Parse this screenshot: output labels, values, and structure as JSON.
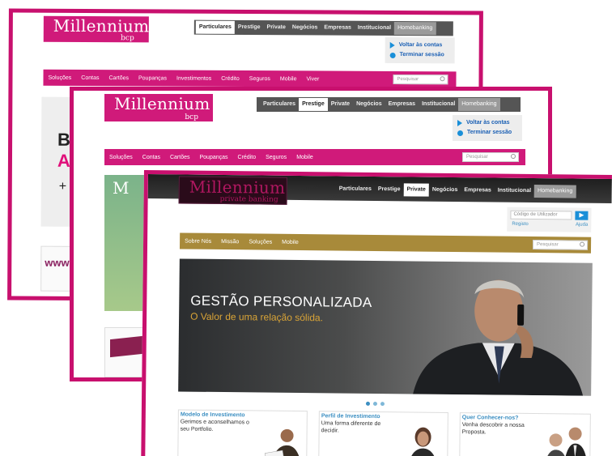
{
  "window1": {
    "logo_big": "Millennium",
    "logo_small": "bcp",
    "nav": [
      "Particulares",
      "Prestige",
      "Private",
      "Negócios",
      "Empresas",
      "Institucional",
      "Homebanking"
    ],
    "actions": [
      "Voltar às contas",
      "Terminar sessão"
    ],
    "menu": [
      "Soluções",
      "Contas",
      "Cartões",
      "Poupanças",
      "Investimentos",
      "Crédito",
      "Seguros",
      "Mobile",
      "Viver"
    ],
    "search_placeholder": "Pesquisar",
    "banner_text": [
      "B",
      "A",
      "+"
    ],
    "promo_text": "www"
  },
  "window2": {
    "logo_big": "Millennium",
    "logo_small": "bcp",
    "nav": [
      "Particulares",
      "Prestige",
      "Private",
      "Negócios",
      "Empresas",
      "Institucional",
      "Homebanking"
    ],
    "actions": [
      "Voltar às contas",
      "Terminar sessão"
    ],
    "menu": [
      "Soluções",
      "Contas",
      "Cartões",
      "Poupanças",
      "Crédito",
      "Seguros",
      "Mobile"
    ],
    "search_placeholder": "Pesquisar",
    "banner_letter": "M"
  },
  "window3": {
    "logo_big": "Millennium",
    "logo_small": "private banking",
    "nav": [
      "Particulares",
      "Prestige",
      "Private",
      "Negócios",
      "Empresas",
      "Institucional",
      "Homebanking"
    ],
    "login_placeholder": "Código de Utilizador",
    "link_register": "Registo",
    "link_help": "Ajuda",
    "menu": [
      "Sobre Nós",
      "Missão",
      "Soluções",
      "Mobile"
    ],
    "search_placeholder": "Pesquisar",
    "hero_title": "GESTÃO PERSONALIZADA",
    "hero_subtitle": "O Valor de uma relação sólida.",
    "cards": [
      {
        "title": "Modelo de Investimento",
        "body": "Gerimos e aconselhamos o seu Portfolio."
      },
      {
        "title": "Perfil de Investimento",
        "body": "Uma forma diferente de decidir."
      },
      {
        "title": "Quer Conhecer-nos?",
        "body": "Venha descobrir a nossa Proposta."
      }
    ]
  },
  "colors": {
    "brand_magenta": "#c8106e",
    "private_gold": "#a88a3a",
    "link_blue": "#3c8fc2"
  }
}
